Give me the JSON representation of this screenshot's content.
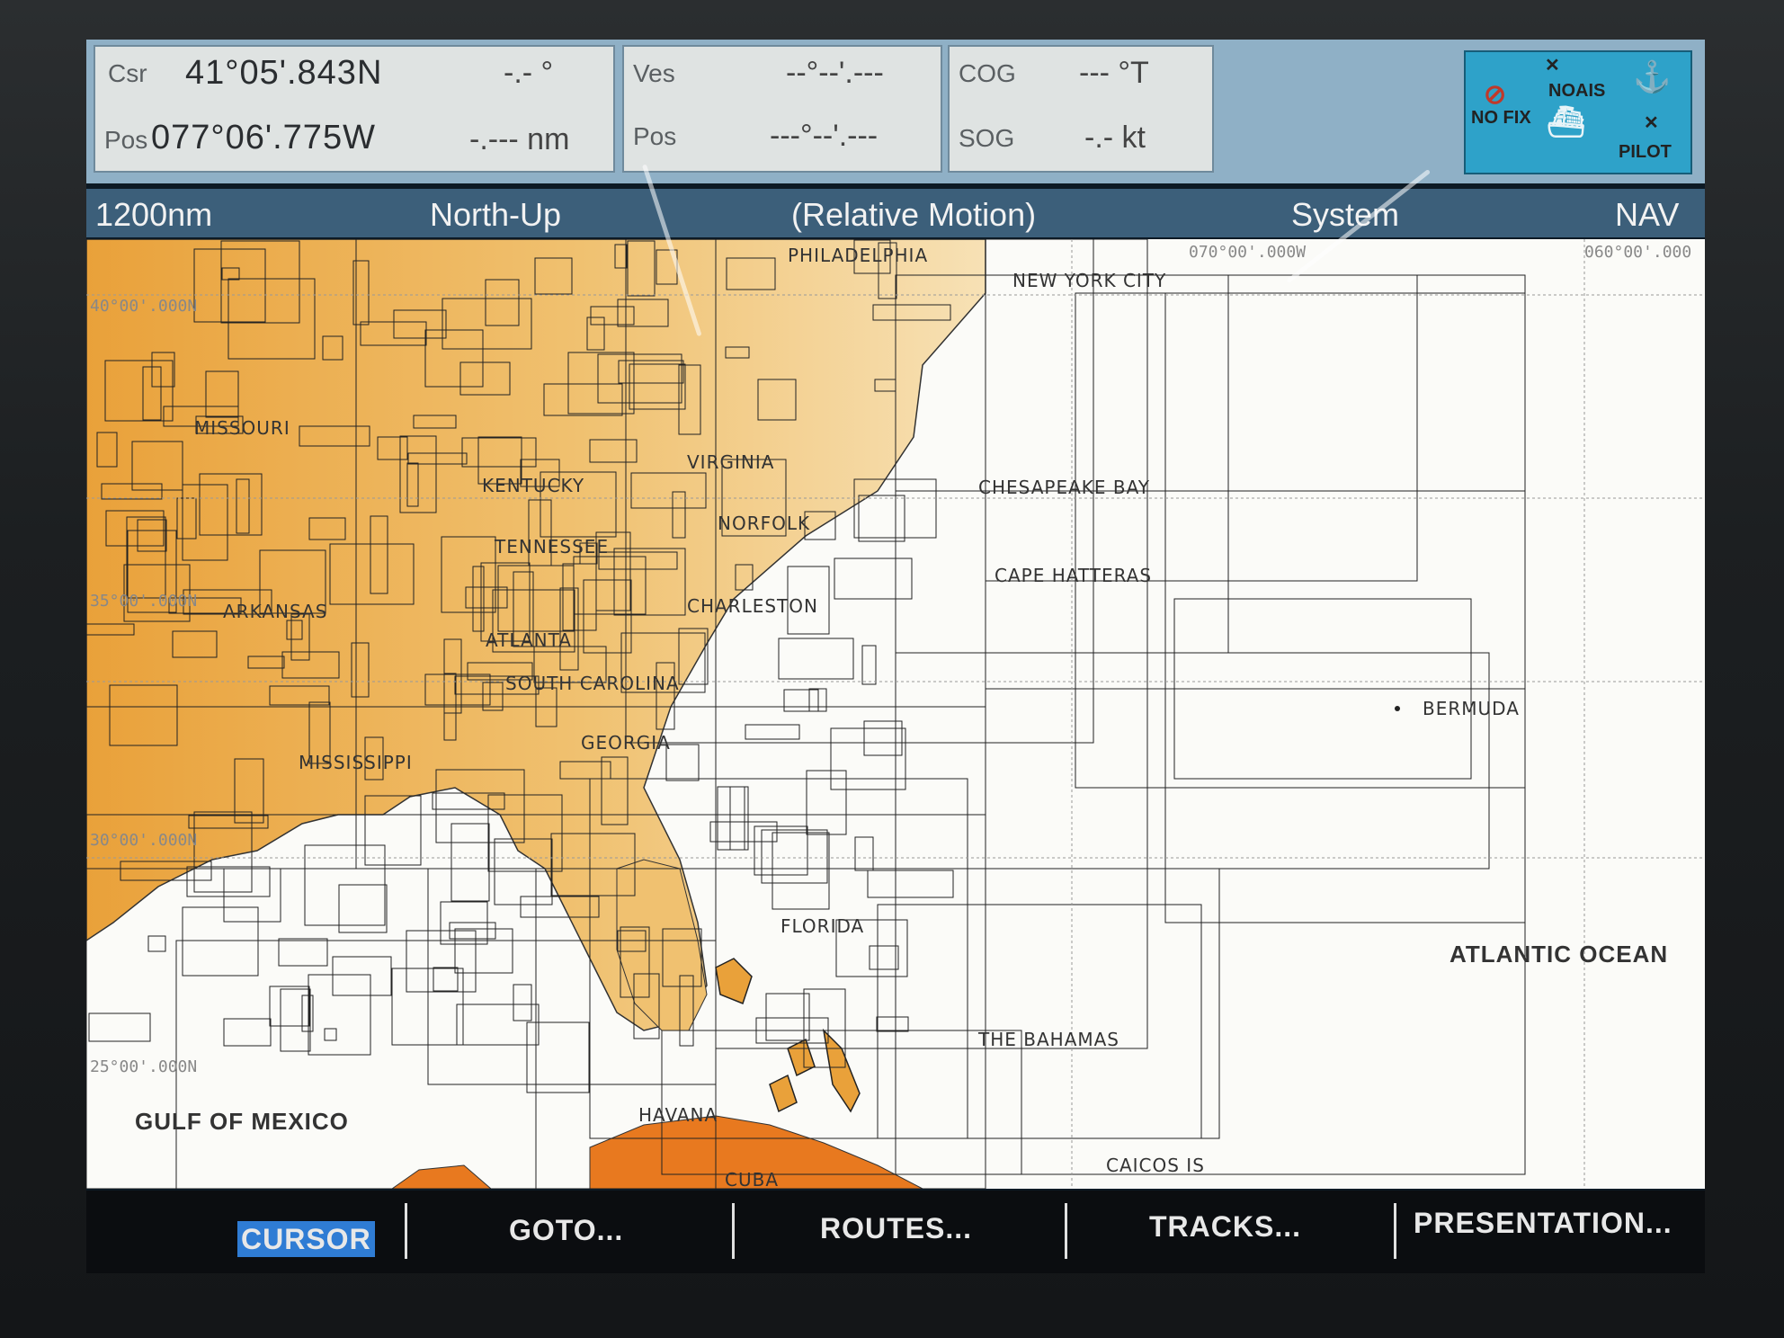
{
  "data_bar": {
    "cursor": {
      "csr_label": "Csr",
      "pos_label": "Pos",
      "lat": "41°05'.843N",
      "lon": "077°06'.775W",
      "bearing": "-.- °",
      "distance": "-.--- nm"
    },
    "vessel": {
      "ves_label": "Ves",
      "pos_label": "Pos",
      "lat": "--°--'.---",
      "lon": "---°--'.---"
    },
    "nav": {
      "cog_label": "COG",
      "cog_value": "--- °T",
      "sog_label": "SOG",
      "sog_value": "-.- kt"
    },
    "status": {
      "no_fix": "NO FIX",
      "no_ais": "NOAIS",
      "pilot": "PILOT"
    }
  },
  "header": {
    "range": "1200nm",
    "orientation": "North-Up",
    "motion": "(Relative Motion)",
    "system": "System",
    "mode": "NAV"
  },
  "chart": {
    "places": {
      "missouri": "MISSOURI",
      "virginia": "VIRGINIA",
      "norfolk": "NORFOLK",
      "chesapeake": "CHESAPEAKE BAY",
      "hatteras": "CAPE HATTERAS",
      "charleston": "CHARLESTON",
      "arkansas": "ARKANSAS",
      "atlanta": "ATLANTA",
      "south_carolina": "SOUTH CAROLINA",
      "georgia": "GEORGIA",
      "bermuda": "BERMUDA",
      "mississippi": "MISSISSIPPI",
      "florida": "FLORIDA",
      "bahamas": "THE BAHAMAS",
      "havana": "HAVANA",
      "caicos": "CAICOS IS",
      "cuba": "CUBA",
      "philadelphia": "PHILADELPHIA",
      "new_york": "NEW YORK CITY",
      "kentucky": "KENTUCKY",
      "tennessee": "TENNESSEE"
    },
    "oceans": {
      "atlantic": "ATLANTIC OCEAN",
      "gulf": "GULF OF MEXICO"
    },
    "grid": {
      "lon_70": "070°00'.000W",
      "lon_60": "060°00'.000",
      "lat_40": "40°00'.000N",
      "lat_35": "35°00'.000N",
      "lat_30": "30°00'.000N",
      "lat_25": "25°00'.000N"
    },
    "colors": {
      "land": "#e9a13a",
      "land_light": "#f4d7a3",
      "cuba": "#e8791f",
      "water": "#fbfbf8"
    }
  },
  "softkeys": [
    {
      "label": "CURSOR",
      "active": true
    },
    {
      "label": "GOTO...",
      "active": false
    },
    {
      "label": "ROUTES...",
      "active": false
    },
    {
      "label": "TRACKS...",
      "active": false
    },
    {
      "label": "PRESENTATION...",
      "active": false
    }
  ]
}
